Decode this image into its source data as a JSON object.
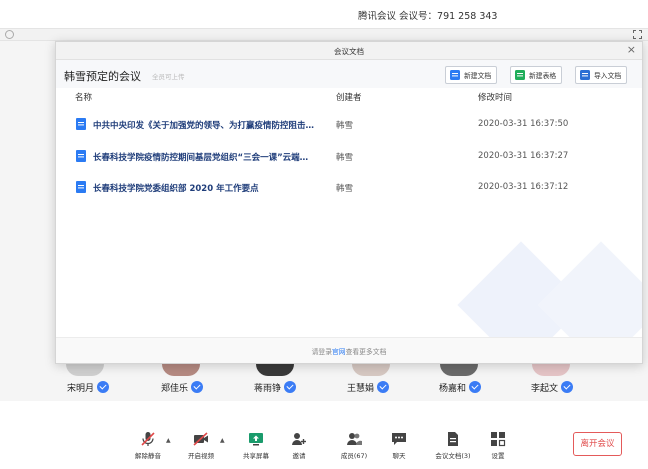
{
  "meeting": {
    "title": "腾讯会议 会议号：791 258 343"
  },
  "dialog": {
    "title": "会议文档",
    "meeting_name": "韩雪预定的会议",
    "upload_hint": "全员可上传",
    "buttons": [
      {
        "label": "新建文档",
        "color": "#2b7bf3"
      },
      {
        "label": "新建表格",
        "color": "#1fae5a"
      },
      {
        "label": "导入文档",
        "color": "#2b6fd4"
      }
    ],
    "columns": {
      "name": "名称",
      "creator": "创建者",
      "modified": "修改时间"
    },
    "files": [
      {
        "name": "中共中央印发《关于加强党的领导、为打赢疫情防控阻击…",
        "creator": "韩雪",
        "modified": "2020-03-31 16:37:50",
        "icon": "doc-icon"
      },
      {
        "name": "长春科技学院疫情防控期间基层党组织“三会一课”云端…",
        "creator": "韩雪",
        "modified": "2020-03-31 16:37:27",
        "icon": "doc-icon"
      },
      {
        "name": "长春科技学院党委组织部 2020 年工作要点",
        "creator": "韩雪",
        "modified": "2020-03-31 16:37:12",
        "icon": "doc-icon"
      }
    ],
    "footer": {
      "prefix": "请登录",
      "link": "官网",
      "suffix": "查看更多文档"
    }
  },
  "participants": [
    {
      "name": "宋明月"
    },
    {
      "name": "郑佳乐"
    },
    {
      "name": "蒋雨铮"
    },
    {
      "name": "王慧娟"
    },
    {
      "name": "杨嘉和"
    },
    {
      "name": "李起文"
    }
  ],
  "toolbar": {
    "items": [
      {
        "label": "解除静音",
        "icon": "mic-muted-icon"
      },
      {
        "label": "开启视频",
        "icon": "camera-off-icon"
      },
      {
        "label": "共享屏幕",
        "icon": "screen-share-icon"
      },
      {
        "label": "邀请",
        "icon": "invite-icon"
      },
      {
        "label": "成员(67)",
        "icon": "members-icon"
      },
      {
        "label": "聊天",
        "icon": "chat-icon"
      },
      {
        "label": "会议文档(3)",
        "icon": "document-icon"
      },
      {
        "label": "设置",
        "icon": "settings-icon"
      }
    ],
    "leave_label": "离开会议"
  },
  "colors": {
    "accent": "#2b7bf3",
    "leave": "#e04848",
    "verify": "#3b7cf5"
  }
}
